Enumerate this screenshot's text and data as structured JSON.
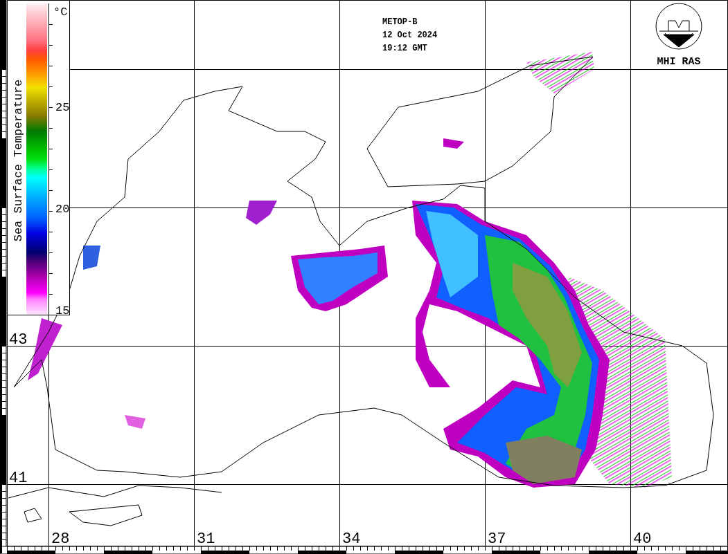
{
  "header": {
    "satellite": "METOP-B",
    "date": "12 Oct 2024",
    "time": "19:12 GMT"
  },
  "logo": {
    "text": "MHI RAS"
  },
  "legend": {
    "title": "Sea Surface Temperature",
    "unit": "°C",
    "ticks": [
      "25",
      "20",
      "15"
    ]
  },
  "latitude_labels": [
    "43",
    "41"
  ],
  "longitude_labels": [
    "28",
    "31",
    "34",
    "37",
    "40"
  ]
}
